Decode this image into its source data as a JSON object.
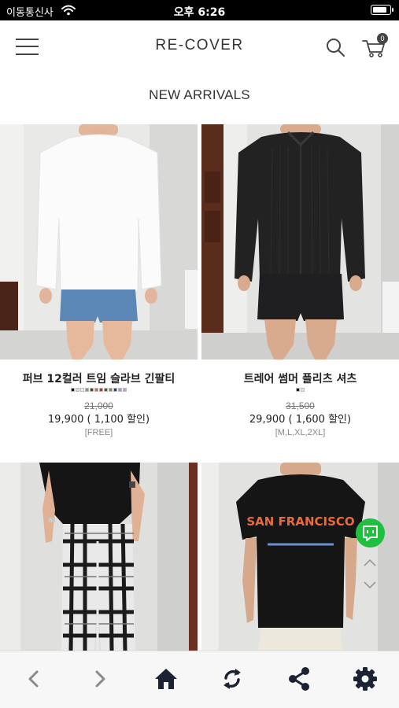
{
  "status_bar": {
    "carrier": "이동통신사",
    "time": "오후 6:26",
    "battery_level": 0.85
  },
  "header": {
    "brand": "RE-COVER",
    "cart_count": "0",
    "icons": [
      "menu-icon",
      "search-icon",
      "cart-icon"
    ]
  },
  "section": {
    "title": "NEW ARRIVALS"
  },
  "products": [
    {
      "name": "퍼브 12컬러 트임 슬라브 긴팔티",
      "price_original": "21,000",
      "price_sale": "19,900 ( 1,100 할인)",
      "sizes": "[FREE]",
      "colors": [
        "#111111",
        "#dcdcdc",
        "#f2efe6",
        "#9a8c7a",
        "#5a3a2a",
        "#e2622a",
        "#b23030",
        "#4a5a30",
        "#8a8a30",
        "#2a3a6a",
        "#8aa6c8",
        "#c8a0b4"
      ]
    },
    {
      "name": "트레어 썸머 플리츠 셔츠",
      "price_original": "31,500",
      "price_sale": "29,900 ( 1,600 할인)",
      "sizes": "[M,L,XL,2XL]",
      "colors": [
        "#111111",
        "#e9e4d6"
      ]
    },
    {
      "name": "",
      "colors": []
    },
    {
      "name": "",
      "tee_print": "SAN FRANCISCO",
      "colors": []
    }
  ],
  "floating": {
    "icons": [
      "chat-icon",
      "chevron-up-icon",
      "chevron-down-icon"
    ],
    "chat_color": "#1fbf3f"
  },
  "bottom_nav": {
    "icons": [
      "back-arrow-icon",
      "forward-arrow-icon",
      "home-icon",
      "refresh-icon",
      "share-icon",
      "settings-icon"
    ]
  }
}
